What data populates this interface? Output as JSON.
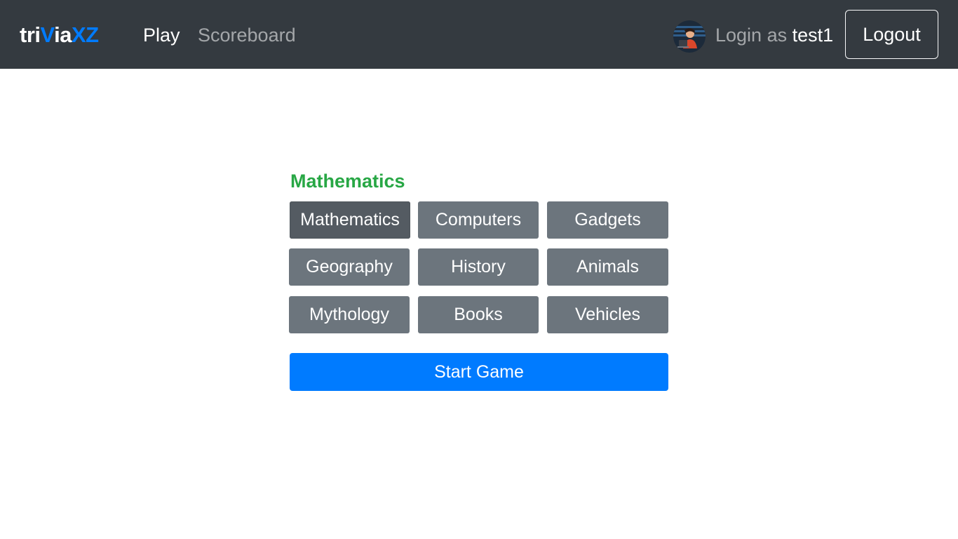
{
  "navbar": {
    "brand_part1": "tri",
    "brand_part2": "V",
    "brand_part3": "ia",
    "brand_part4": "XZ",
    "links": [
      {
        "label": "Play"
      },
      {
        "label": "Scoreboard"
      }
    ],
    "login_prefix": "Login as",
    "username": "test1",
    "logout_label": "Logout",
    "avatar_icon": "user-avatar-icon"
  },
  "main": {
    "selected_category": "Mathematics",
    "categories": [
      {
        "label": "Mathematics",
        "active": true
      },
      {
        "label": "Computers",
        "active": false
      },
      {
        "label": "Gadgets",
        "active": false
      },
      {
        "label": "Geography",
        "active": false
      },
      {
        "label": "History",
        "active": false
      },
      {
        "label": "Animals",
        "active": false
      },
      {
        "label": "Mythology",
        "active": false
      },
      {
        "label": "Books",
        "active": false
      },
      {
        "label": "Vehicles",
        "active": false
      }
    ],
    "start_label": "Start Game"
  },
  "colors": {
    "navbar_bg": "#343a40",
    "brand_accent": "#007bff",
    "selected_title": "#28a745",
    "category_button": "#6c757d",
    "category_active": "#545b62",
    "start_button": "#007bff"
  }
}
